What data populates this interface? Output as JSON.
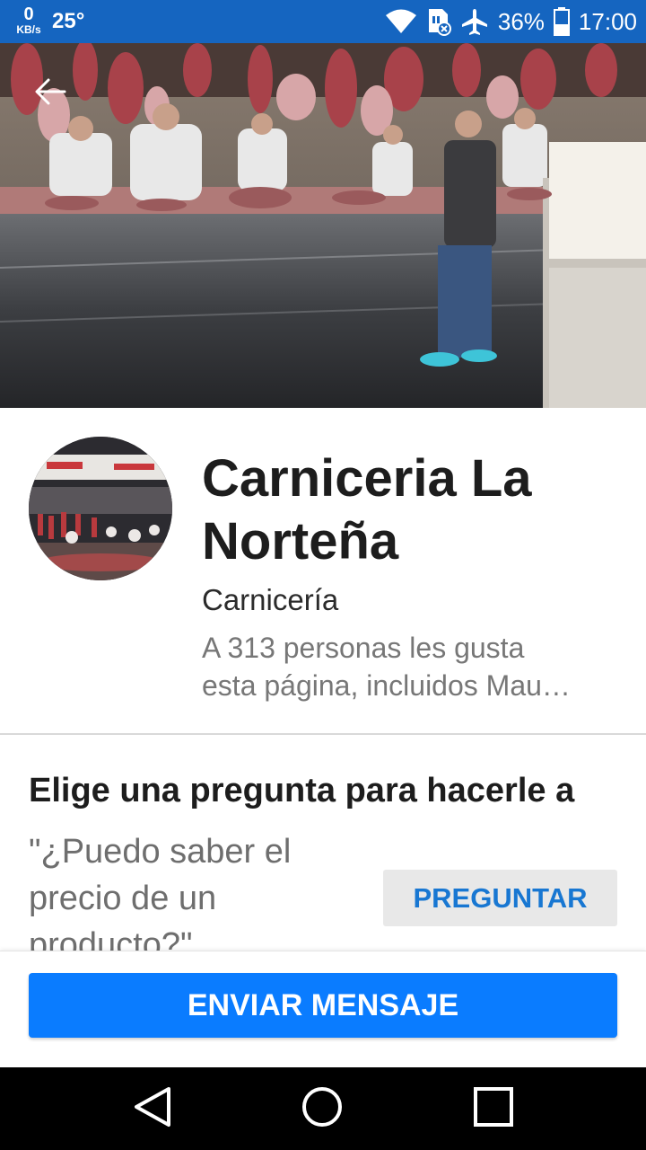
{
  "status_bar": {
    "net_speed": "0",
    "net_speed_unit": "KB/s",
    "temperature": "25°",
    "battery": "36%",
    "time": "17:00",
    "icons": [
      "wifi-icon",
      "sim-blocked-icon",
      "airplane-icon",
      "battery-icon"
    ]
  },
  "header": {
    "back_icon": "back-arrow-icon"
  },
  "page": {
    "name": "Carniceria La Norteña",
    "category": "Carnicería",
    "likes_line1": "A 313 personas les gusta",
    "likes_line2": "esta página, incluidos Mau…"
  },
  "question": {
    "title": "Elige una pregunta para hacerle a",
    "text": "\"¿Puedo saber el precio de un producto?\"",
    "ask_label": "PREGUNTAR"
  },
  "actions": {
    "send_message_label": "ENVIAR MENSAJE"
  },
  "colors": {
    "status_bar": "#1565c0",
    "primary_button": "#0a7cff",
    "link_blue": "#1877d2"
  }
}
